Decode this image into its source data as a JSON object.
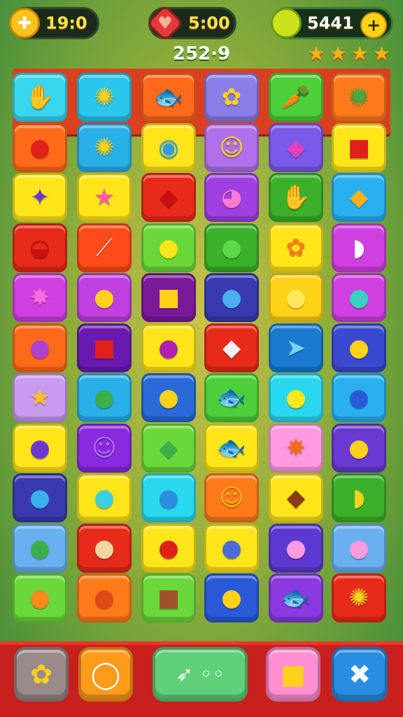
{
  "hud": {
    "left": {
      "icon": "gift-icon",
      "glyph": "✚",
      "value": "19:0"
    },
    "middle": {
      "icon": "heart-gem-icon",
      "glyph": "♥",
      "value": "5:00"
    },
    "right": {
      "icon": "lime-coin-icon",
      "glyph": "",
      "value": "5441",
      "plus_glyph": "+"
    }
  },
  "score": "252·9",
  "stars": {
    "count": 4,
    "glyph": "★"
  },
  "board": {
    "columns": 6,
    "rows": 11,
    "highlighted_row": 0,
    "tiles": [
      [
        {
          "color": "#39d7ee",
          "glyph": "✋",
          "icon": "orange-hand-icon",
          "fg": "#ff6a1a"
        },
        {
          "color": "#2ac6ec",
          "glyph": "✺",
          "icon": "yellow-sun-face-icon",
          "fg": "#ffd21a"
        },
        {
          "color": "#ff6a1a",
          "glyph": "🐟",
          "icon": "green-fish-icon",
          "fg": "#3bb04a"
        },
        {
          "color": "#8a7ee8",
          "glyph": "✿",
          "icon": "yellow-flower-face-icon",
          "fg": "#ffd21a"
        },
        {
          "color": "#4ccf3a",
          "glyph": "🥕",
          "icon": "carrot-icon",
          "fg": "#ff6a1a"
        },
        {
          "color": "#ff7a1a",
          "glyph": "✺",
          "icon": "green-wreath-icon",
          "fg": "#3bb04a"
        }
      ],
      [
        {
          "color": "#ff6a1a",
          "glyph": "●",
          "icon": "red-cherry-icon",
          "fg": "#e0201a"
        },
        {
          "color": "#2ab0e8",
          "glyph": "✺",
          "icon": "yellow-flower-icon",
          "fg": "#ffd21a"
        },
        {
          "color": "#ffe51a",
          "glyph": "◉",
          "icon": "blue-swirl-icon",
          "fg": "#2a9ee8"
        },
        {
          "color": "#b070e8",
          "glyph": "☺",
          "icon": "yellow-smiley-icon",
          "fg": "#ffd21a"
        },
        {
          "color": "#7a5ae8",
          "glyph": "◆",
          "icon": "pink-bag-icon",
          "fg": "#e040c0"
        },
        {
          "color": "#ffe51a",
          "glyph": "■",
          "icon": "red-box-icon",
          "fg": "#e0201a"
        }
      ],
      [
        {
          "color": "#ffe51a",
          "glyph": "✦",
          "icon": "purple-fish-icon",
          "fg": "#6a3ad0"
        },
        {
          "color": "#ffe51a",
          "glyph": "★",
          "icon": "pink-star-icon",
          "fg": "#ff5ab0"
        },
        {
          "color": "#e82a1a",
          "glyph": "◆",
          "icon": "red-leaf-icon",
          "fg": "#c81010"
        },
        {
          "color": "#a040e0",
          "glyph": "◕",
          "icon": "pink-shell-icon",
          "fg": "#ff7ad0"
        },
        {
          "color": "#3bb02a",
          "glyph": "✋",
          "icon": "green-hand-icon",
          "fg": "#7ae05a"
        },
        {
          "color": "#2ab0ee",
          "glyph": "◆",
          "icon": "orange-leaf-icon",
          "fg": "#ffb01a"
        }
      ],
      [
        {
          "color": "#e82a1a",
          "glyph": "◒",
          "icon": "red-blob-icon",
          "fg": "#c81010"
        },
        {
          "color": "#ff4a1a",
          "glyph": "⟋",
          "icon": "silver-fish-icon",
          "fg": "#d8d8d8"
        },
        {
          "color": "#6ad83a",
          "glyph": "●",
          "icon": "yellow-blob-icon",
          "fg": "#ffe51a"
        },
        {
          "color": "#3bb02a",
          "glyph": "●",
          "icon": "green-fish-blob-icon",
          "fg": "#5ad84a"
        },
        {
          "color": "#ffe51a",
          "glyph": "✿",
          "icon": "orange-splat-icon",
          "fg": "#ff7a1a"
        },
        {
          "color": "#d040e0",
          "glyph": "◗",
          "icon": "white-shell-icon",
          "fg": "#ffffff"
        }
      ],
      [
        {
          "color": "#d040e0",
          "glyph": "✸",
          "icon": "pink-splat-icon",
          "fg": "#ff6ae0"
        },
        {
          "color": "#c040e0",
          "glyph": "●",
          "icon": "yellow-drop-icon",
          "fg": "#ffd21a"
        },
        {
          "color": "#7a1a9a",
          "glyph": "■",
          "icon": "yellow-box-icon",
          "fg": "#ffd21a"
        },
        {
          "color": "#3a3ab0",
          "glyph": "●",
          "icon": "blue-fish-icon",
          "fg": "#4ab0f0"
        },
        {
          "color": "#ffd21a",
          "glyph": "●",
          "icon": "yellow-bean-icon",
          "fg": "#ffe85a"
        },
        {
          "color": "#d040e0",
          "glyph": "●",
          "icon": "teal-fish-icon",
          "fg": "#3ad0c0"
        }
      ],
      [
        {
          "color": "#ff6a1a",
          "glyph": "●",
          "icon": "purple-fish-icon",
          "fg": "#b040d0"
        },
        {
          "color": "#6a1ab0",
          "glyph": "■",
          "icon": "red-square-icon",
          "fg": "#e0201a"
        },
        {
          "color": "#ffe51a",
          "glyph": "●",
          "icon": "purple-apple-icon",
          "fg": "#b020b0"
        },
        {
          "color": "#e82a1a",
          "glyph": "◆",
          "icon": "white-block-icon",
          "fg": "#f0f0f0"
        },
        {
          "color": "#1a7ad0",
          "glyph": "➤",
          "icon": "blue-fish-icon",
          "fg": "#7ad0ff"
        },
        {
          "color": "#3a4ad0",
          "glyph": "●",
          "icon": "yellow-fish-icon",
          "fg": "#ffd21a"
        }
      ],
      [
        {
          "color": "#c89af0",
          "glyph": "★",
          "icon": "yellow-star-icon",
          "fg": "#ffc21a"
        },
        {
          "color": "#2ab0e8",
          "glyph": "●",
          "icon": "green-turtle-icon",
          "fg": "#3bb04a"
        },
        {
          "color": "#2a6ad8",
          "glyph": "●",
          "icon": "yellow-fish-icon",
          "fg": "#ffd21a"
        },
        {
          "color": "#4ccf3a",
          "glyph": "🐟",
          "icon": "green-fish-icon",
          "fg": "#2a8a2a"
        },
        {
          "color": "#2ad8ee",
          "glyph": "●",
          "icon": "yellow-bird-icon",
          "fg": "#ffe51a"
        },
        {
          "color": "#2ab0ee",
          "glyph": "●",
          "icon": "blue-whale-icon",
          "fg": "#2a5ad8"
        }
      ],
      [
        {
          "color": "#ffe51a",
          "glyph": "●",
          "icon": "purple-berry-icon",
          "fg": "#6a3ad0"
        },
        {
          "color": "#8a2ae0",
          "glyph": "☺",
          "icon": "purple-ball-icon",
          "fg": "#b070f0"
        },
        {
          "color": "#6ad83a",
          "glyph": "◆",
          "icon": "green-leaf-icon",
          "fg": "#3bb04a"
        },
        {
          "color": "#ffe51a",
          "glyph": "🐟",
          "icon": "pink-fish-icon",
          "fg": "#ff5ab0"
        },
        {
          "color": "#ff9ae0",
          "glyph": "✸",
          "icon": "orange-star-icon",
          "fg": "#ff6a1a"
        },
        {
          "color": "#6a3ad0",
          "glyph": "●",
          "icon": "yellow-lemon-icon",
          "fg": "#ffd21a"
        }
      ],
      [
        {
          "color": "#3a3ab0",
          "glyph": "●",
          "icon": "blue-planet-icon",
          "fg": "#3ab0f0"
        },
        {
          "color": "#ffe51a",
          "glyph": "●",
          "icon": "teal-fish-icon",
          "fg": "#3ad0e0"
        },
        {
          "color": "#2ad8ee",
          "glyph": "●",
          "icon": "blue-whale-icon",
          "fg": "#2a8ee0"
        },
        {
          "color": "#ff7a1a",
          "glyph": "☺",
          "icon": "orange-face-icon",
          "fg": "#ffb01a"
        },
        {
          "color": "#ffe51a",
          "glyph": "◆",
          "icon": "chocolate-icon",
          "fg": "#8a3a1a"
        },
        {
          "color": "#3bb02a",
          "glyph": "◗",
          "icon": "banana-leaf-icon",
          "fg": "#ffd21a"
        }
      ],
      [
        {
          "color": "#6ab0f0",
          "glyph": "●",
          "icon": "green-ball-icon",
          "fg": "#3bb04a"
        },
        {
          "color": "#e82a1a",
          "glyph": "●",
          "icon": "cookie-icon",
          "fg": "#f0d8a0"
        },
        {
          "color": "#ffe51a",
          "glyph": "●",
          "icon": "red-fish-icon",
          "fg": "#e0201a"
        },
        {
          "color": "#ffe51a",
          "glyph": "●",
          "icon": "blue-fish-icon",
          "fg": "#4a6ad8"
        },
        {
          "color": "#5a3ad0",
          "glyph": "●",
          "icon": "pink-dolphin-icon",
          "fg": "#ff9ae0"
        },
        {
          "color": "#6ab0f0",
          "glyph": "●",
          "icon": "pink-drop-icon",
          "fg": "#ff9ae0"
        }
      ],
      [
        {
          "color": "#6ad83a",
          "glyph": "●",
          "icon": "orange-blob-icon",
          "fg": "#ff8a1a"
        },
        {
          "color": "#ff7a1a",
          "glyph": "●",
          "icon": "orange-planet-icon",
          "fg": "#e04a1a"
        },
        {
          "color": "#6ad83a",
          "glyph": "■",
          "icon": "crate-icon",
          "fg": "#a0522a"
        },
        {
          "color": "#2a5ad8",
          "glyph": "●",
          "icon": "yellow-eye-icon",
          "fg": "#ffd21a"
        },
        {
          "color": "#8a3ae0",
          "glyph": "🐟",
          "icon": "green-fish-icon",
          "fg": "#3bd04a"
        },
        {
          "color": "#e82a1a",
          "glyph": "✺",
          "icon": "sun-icon",
          "fg": "#ffd21a"
        }
      ]
    ]
  },
  "bottom_bar": {
    "buttons": [
      {
        "name": "popcorn-booster-button",
        "icon": "popcorn-icon",
        "glyph": "✿"
      },
      {
        "name": "clock-booster-button",
        "icon": "clock-icon",
        "glyph": "◯"
      },
      {
        "name": "swap-booster-button",
        "icon": "arrow-swap-icon",
        "glyph": "➶ ◦◦"
      },
      {
        "name": "box-booster-button",
        "icon": "gift-box-icon",
        "glyph": "■"
      },
      {
        "name": "shuffle-booster-button",
        "icon": "crossed-arrows-icon",
        "glyph": "✖"
      }
    ]
  }
}
